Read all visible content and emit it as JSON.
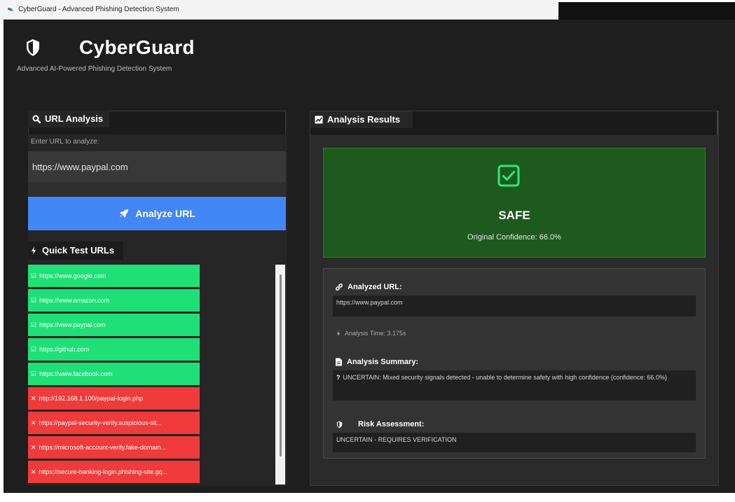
{
  "window": {
    "title": "CyberGuard - Advanced Phishing Detection System",
    "icon": "feather-icon"
  },
  "header": {
    "title": "CyberGuard",
    "subtitle": "Advanced AI-Powered Phishing Detection System",
    "logo_icon": "shield-icon"
  },
  "url_analysis": {
    "section_label": "URL Analysis",
    "section_icon": "search-icon",
    "field_label": "Enter URL to analyze:",
    "input_value": "https://www.paypal.com",
    "analyze_button": "Analyze URL",
    "analyze_icon": "rocket-icon"
  },
  "quick_test": {
    "label": "Quick Test URLs",
    "icon": "lightning-icon",
    "items": [
      {
        "text": "https://www.google.com",
        "status": "safe"
      },
      {
        "text": "https://www.amazon.com",
        "status": "safe"
      },
      {
        "text": "https://www.paypal.com",
        "status": "safe"
      },
      {
        "text": "https://github.com",
        "status": "safe"
      },
      {
        "text": "https://www.facebook.com",
        "status": "safe"
      },
      {
        "text": "http://192.168.1.100/paypal-login.php",
        "status": "unsafe"
      },
      {
        "text": "https://paypal-security-verify.suspicious-sit...",
        "status": "unsafe"
      },
      {
        "text": "https://microsoft-account-verify.fake-domain...",
        "status": "unsafe"
      },
      {
        "text": "https://secure-banking-login.phishing-site.gq...",
        "status": "unsafe"
      }
    ]
  },
  "results": {
    "section_label": "Analysis Results",
    "section_icon": "chart-icon",
    "status": "SAFE",
    "confidence_text": "Original Confidence: 66.0%",
    "status_icon": "checkbox-icon",
    "analyzed_url_label": "Analyzed URL:",
    "analyzed_url_value": "https://www.paypal.com",
    "analysis_time": "Analysis Time: 3.175s",
    "summary_label": "Analysis Summary:",
    "summary_value": "UNCERTAIN: Mixed security signals detected - unable to determine safety with high confidence (confidence: 66.0%)",
    "summary_prefix": "?",
    "risk_label": "Risk Assessment:",
    "risk_value": "UNCERTAIN - REQUIRES VERIFICATION"
  },
  "colors": {
    "accent_blue": "#4287f5",
    "safe_green": "#1fe077",
    "unsafe_red": "#ef3b3b",
    "result_safe_bg": "#1e5a1e",
    "check_green": "#2ee87a"
  }
}
